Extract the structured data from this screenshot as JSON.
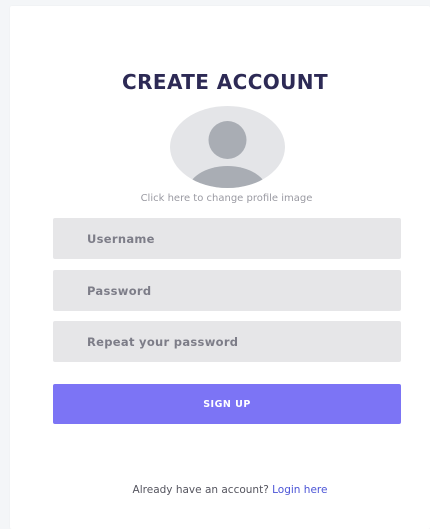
{
  "form": {
    "title": "CREATE ACCOUNT",
    "avatar_caption": "Click here to change profile image",
    "username_placeholder": "Username",
    "password_placeholder": "Password",
    "repeat_placeholder": "Repeat your password",
    "submit_label": "SIGN UP"
  },
  "footer": {
    "prompt": "Already have an account?",
    "login_link": "Login here"
  },
  "icons": {
    "avatar": "user-silhouette-icon"
  },
  "colors": {
    "title": "#2d2a55",
    "button": "#7c74f5",
    "link": "#4b54d6",
    "field_bg": "#e6e6e8",
    "avatar_bg": "#e4e5e8",
    "avatar_figure": "#a9adb4"
  }
}
